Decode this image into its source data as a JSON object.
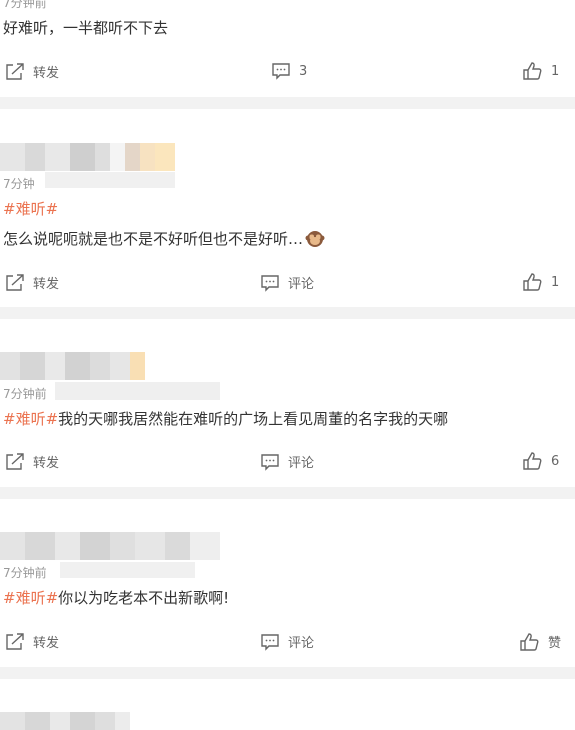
{
  "comments": [
    {
      "time": "7分钟前",
      "text": "好难听，一半都听不下去",
      "actions": {
        "repost": "转发",
        "comment": "3",
        "like": "1"
      }
    },
    {
      "time": "7分钟",
      "tag": "#难听#",
      "text": "怎么说呢呃就是也不是不好听但也不是好听…",
      "emoji": "monkey-covering-eyes-emoji",
      "actions": {
        "repost": "转发",
        "comment": "评论",
        "like": "1"
      }
    },
    {
      "time": "7分钟前",
      "tag": "#难听#",
      "text": "我的天哪我居然能在难听的广场上看见周董的名字我的天哪",
      "actions": {
        "repost": "转发",
        "comment": "评论",
        "like": "6"
      }
    },
    {
      "time": "7分钟前",
      "tag": "#难听#",
      "text": "你以为吃老本不出新歌啊!",
      "actions": {
        "repost": "转发",
        "comment": "评论",
        "like": "赞"
      }
    }
  ],
  "icons": {
    "repost": "repost-icon",
    "comment": "comment-icon",
    "like": "thumbs-up-icon"
  },
  "colors": {
    "tag": "#eb7350",
    "divider": "#f2f2f2",
    "text": "#333333",
    "meta": "#999999"
  }
}
